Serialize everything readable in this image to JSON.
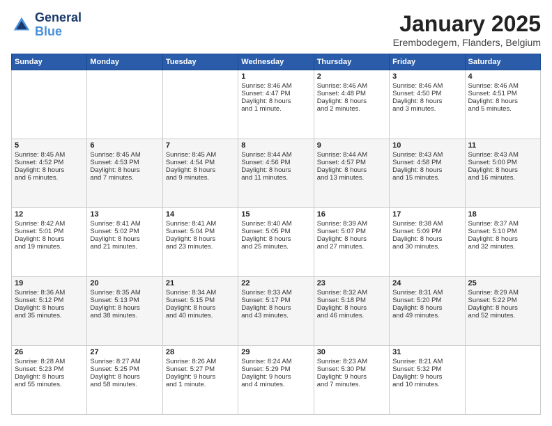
{
  "logo": {
    "line1": "General",
    "line2": "Blue"
  },
  "header": {
    "title": "January 2025",
    "subtitle": "Erembodegem, Flanders, Belgium"
  },
  "weekdays": [
    "Sunday",
    "Monday",
    "Tuesday",
    "Wednesday",
    "Thursday",
    "Friday",
    "Saturday"
  ],
  "weeks": [
    [
      {
        "day": "",
        "content": ""
      },
      {
        "day": "",
        "content": ""
      },
      {
        "day": "",
        "content": ""
      },
      {
        "day": "1",
        "content": "Sunrise: 8:46 AM\nSunset: 4:47 PM\nDaylight: 8 hours\nand 1 minute."
      },
      {
        "day": "2",
        "content": "Sunrise: 8:46 AM\nSunset: 4:48 PM\nDaylight: 8 hours\nand 2 minutes."
      },
      {
        "day": "3",
        "content": "Sunrise: 8:46 AM\nSunset: 4:50 PM\nDaylight: 8 hours\nand 3 minutes."
      },
      {
        "day": "4",
        "content": "Sunrise: 8:46 AM\nSunset: 4:51 PM\nDaylight: 8 hours\nand 5 minutes."
      }
    ],
    [
      {
        "day": "5",
        "content": "Sunrise: 8:45 AM\nSunset: 4:52 PM\nDaylight: 8 hours\nand 6 minutes."
      },
      {
        "day": "6",
        "content": "Sunrise: 8:45 AM\nSunset: 4:53 PM\nDaylight: 8 hours\nand 7 minutes."
      },
      {
        "day": "7",
        "content": "Sunrise: 8:45 AM\nSunset: 4:54 PM\nDaylight: 8 hours\nand 9 minutes."
      },
      {
        "day": "8",
        "content": "Sunrise: 8:44 AM\nSunset: 4:56 PM\nDaylight: 8 hours\nand 11 minutes."
      },
      {
        "day": "9",
        "content": "Sunrise: 8:44 AM\nSunset: 4:57 PM\nDaylight: 8 hours\nand 13 minutes."
      },
      {
        "day": "10",
        "content": "Sunrise: 8:43 AM\nSunset: 4:58 PM\nDaylight: 8 hours\nand 15 minutes."
      },
      {
        "day": "11",
        "content": "Sunrise: 8:43 AM\nSunset: 5:00 PM\nDaylight: 8 hours\nand 16 minutes."
      }
    ],
    [
      {
        "day": "12",
        "content": "Sunrise: 8:42 AM\nSunset: 5:01 PM\nDaylight: 8 hours\nand 19 minutes."
      },
      {
        "day": "13",
        "content": "Sunrise: 8:41 AM\nSunset: 5:02 PM\nDaylight: 8 hours\nand 21 minutes."
      },
      {
        "day": "14",
        "content": "Sunrise: 8:41 AM\nSunset: 5:04 PM\nDaylight: 8 hours\nand 23 minutes."
      },
      {
        "day": "15",
        "content": "Sunrise: 8:40 AM\nSunset: 5:05 PM\nDaylight: 8 hours\nand 25 minutes."
      },
      {
        "day": "16",
        "content": "Sunrise: 8:39 AM\nSunset: 5:07 PM\nDaylight: 8 hours\nand 27 minutes."
      },
      {
        "day": "17",
        "content": "Sunrise: 8:38 AM\nSunset: 5:09 PM\nDaylight: 8 hours\nand 30 minutes."
      },
      {
        "day": "18",
        "content": "Sunrise: 8:37 AM\nSunset: 5:10 PM\nDaylight: 8 hours\nand 32 minutes."
      }
    ],
    [
      {
        "day": "19",
        "content": "Sunrise: 8:36 AM\nSunset: 5:12 PM\nDaylight: 8 hours\nand 35 minutes."
      },
      {
        "day": "20",
        "content": "Sunrise: 8:35 AM\nSunset: 5:13 PM\nDaylight: 8 hours\nand 38 minutes."
      },
      {
        "day": "21",
        "content": "Sunrise: 8:34 AM\nSunset: 5:15 PM\nDaylight: 8 hours\nand 40 minutes."
      },
      {
        "day": "22",
        "content": "Sunrise: 8:33 AM\nSunset: 5:17 PM\nDaylight: 8 hours\nand 43 minutes."
      },
      {
        "day": "23",
        "content": "Sunrise: 8:32 AM\nSunset: 5:18 PM\nDaylight: 8 hours\nand 46 minutes."
      },
      {
        "day": "24",
        "content": "Sunrise: 8:31 AM\nSunset: 5:20 PM\nDaylight: 8 hours\nand 49 minutes."
      },
      {
        "day": "25",
        "content": "Sunrise: 8:29 AM\nSunset: 5:22 PM\nDaylight: 8 hours\nand 52 minutes."
      }
    ],
    [
      {
        "day": "26",
        "content": "Sunrise: 8:28 AM\nSunset: 5:23 PM\nDaylight: 8 hours\nand 55 minutes."
      },
      {
        "day": "27",
        "content": "Sunrise: 8:27 AM\nSunset: 5:25 PM\nDaylight: 8 hours\nand 58 minutes."
      },
      {
        "day": "28",
        "content": "Sunrise: 8:26 AM\nSunset: 5:27 PM\nDaylight: 9 hours\nand 1 minute."
      },
      {
        "day": "29",
        "content": "Sunrise: 8:24 AM\nSunset: 5:29 PM\nDaylight: 9 hours\nand 4 minutes."
      },
      {
        "day": "30",
        "content": "Sunrise: 8:23 AM\nSunset: 5:30 PM\nDaylight: 9 hours\nand 7 minutes."
      },
      {
        "day": "31",
        "content": "Sunrise: 8:21 AM\nSunset: 5:32 PM\nDaylight: 9 hours\nand 10 minutes."
      },
      {
        "day": "",
        "content": ""
      }
    ]
  ]
}
